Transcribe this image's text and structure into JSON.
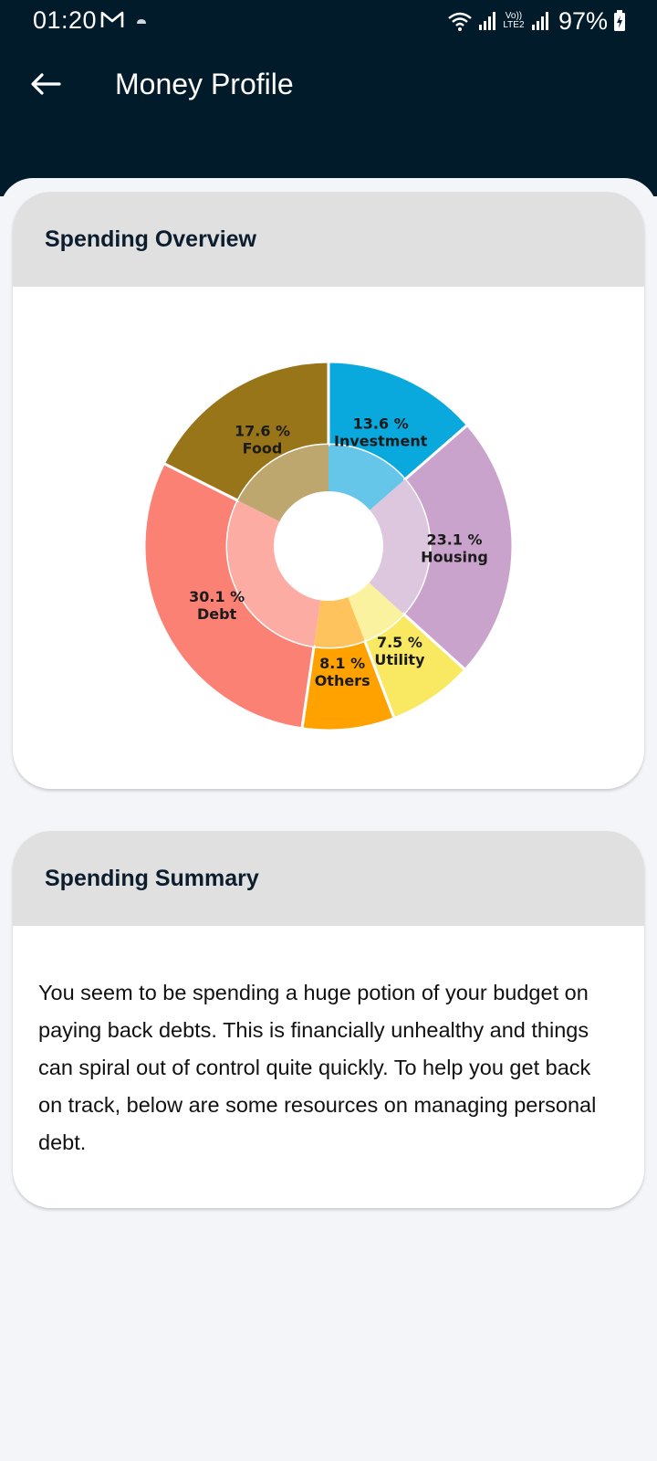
{
  "status_bar": {
    "time": "01:20",
    "network_label": "Vo)) LTE2",
    "battery": "97%"
  },
  "app_bar": {
    "title": "Money Profile",
    "back_icon": "arrow-left-icon"
  },
  "overview_card": {
    "title": "Spending Overview"
  },
  "chart_data": {
    "type": "pie",
    "categories": [
      "Investment",
      "Housing",
      "Utility",
      "Others",
      "Debt",
      "Food"
    ],
    "values": [
      13.6,
      23.1,
      7.5,
      8.1,
      30.1,
      17.6
    ],
    "value_labels": [
      "13.6 %",
      "23.1 %",
      "7.5 %",
      "8.1 %",
      "30.1 %",
      "17.6 %"
    ],
    "unit": "%",
    "colors": [
      "#09a8dd",
      "#c9a3cb",
      "#f9e962",
      "#ffa200",
      "#fa8174",
      "#997519"
    ],
    "inner_colors": [
      "#66c6ea",
      "#dcc7de",
      "#fbf29f",
      "#ffc35e",
      "#fdaca3",
      "#bea66f"
    ],
    "start_angle_deg": 0,
    "direction": "clockwise",
    "title": "",
    "legend": "none"
  },
  "summary_card": {
    "title": "Spending Summary",
    "text": "You seem to be spending a huge potion of your budget on paying back debts. This is financially unhealthy and things can spiral out of control quite quickly. To help you get back on track, below are some resources on managing personal debt."
  }
}
